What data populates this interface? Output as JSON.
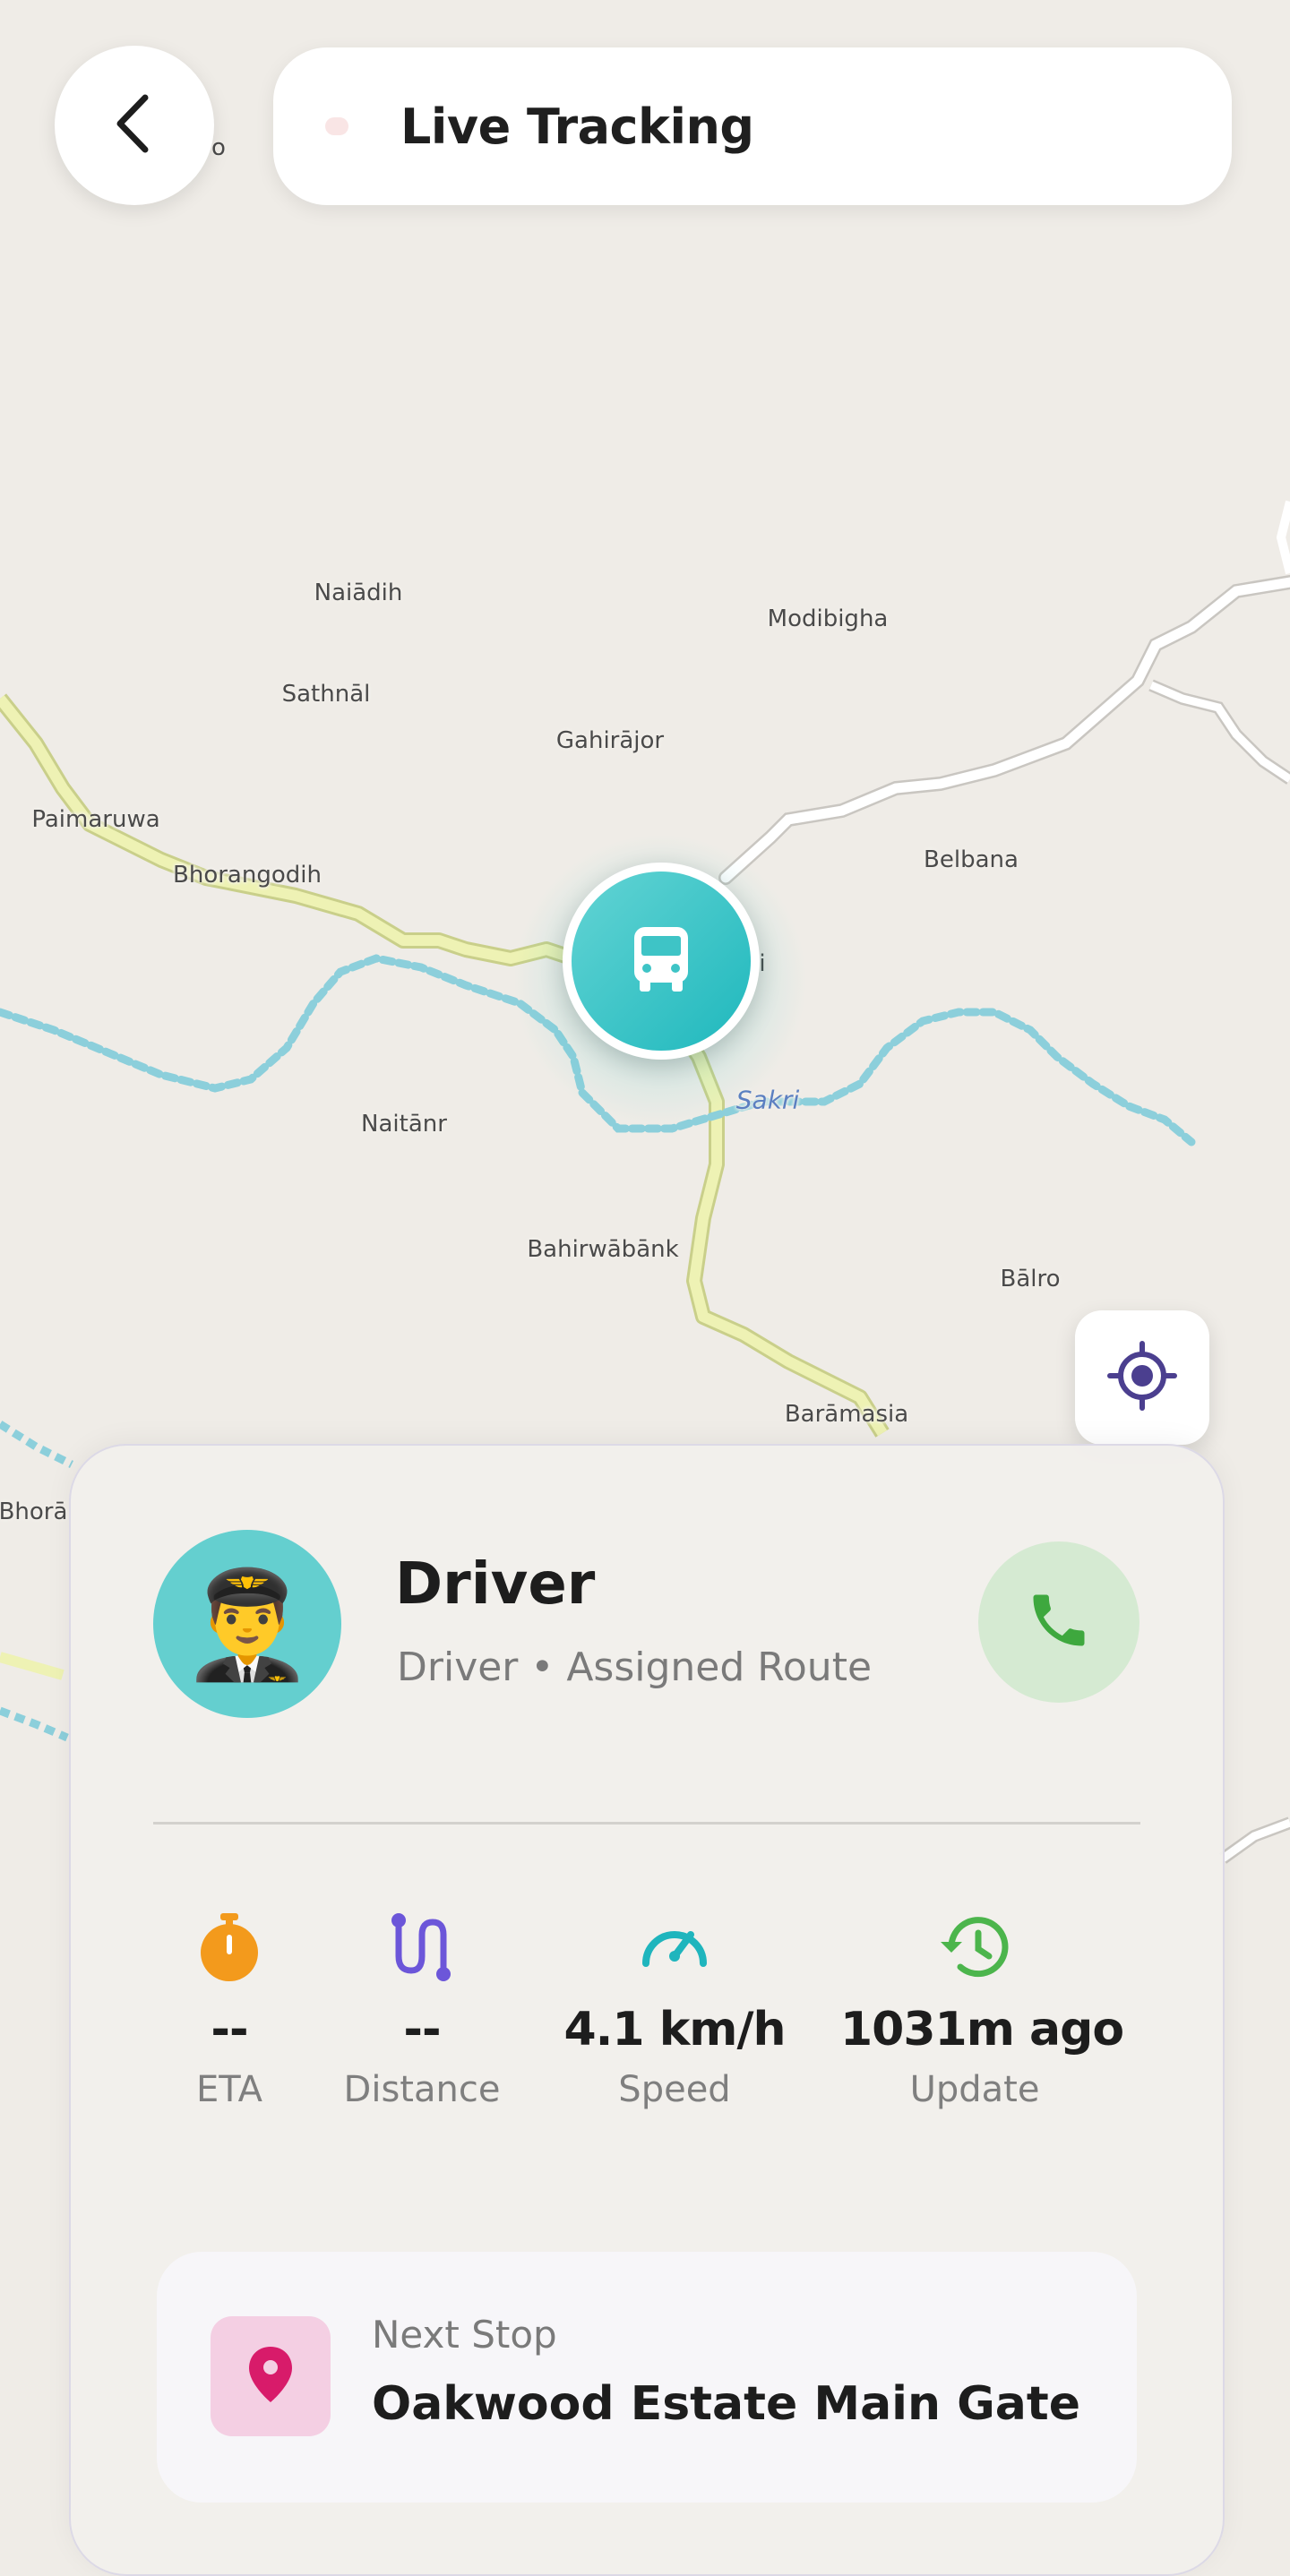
{
  "header": {
    "title": "Live Tracking"
  },
  "map": {
    "places": [
      "Naiādih",
      "Modibigha",
      "Sathnāl",
      "Gahirājor",
      "Paimaruwa",
      "Bhorangodih",
      "Belbana",
      "Naitānr",
      "Bahirwābānk",
      "Bālro",
      "Barāmasia",
      "Bhorā",
      "o",
      "i"
    ],
    "water_label": "Sakri"
  },
  "driver": {
    "avatar_emoji": "👨‍✈️",
    "name": "Driver",
    "subtitle": "Driver • Assigned Route"
  },
  "stats": [
    {
      "icon": "timer-icon",
      "value": "--",
      "label": "ETA",
      "color": "#f39a1c"
    },
    {
      "icon": "route-icon",
      "value": "--",
      "label": "Distance",
      "color": "#6c56d9"
    },
    {
      "icon": "speedometer-icon",
      "value": "4.1 km/h",
      "label": "Speed",
      "color": "#1fb5bd"
    },
    {
      "icon": "history-icon",
      "value": "1031m ago",
      "label": "Update",
      "color": "#4cb54c"
    }
  ],
  "next_stop": {
    "label": "Next Stop",
    "value": "Oakwood Estate Main Gate"
  },
  "colors": {
    "accent": "#1fb8bd",
    "call": "#3ea83e",
    "pin": "#d81b6a",
    "recenter": "#4b3f8f"
  }
}
